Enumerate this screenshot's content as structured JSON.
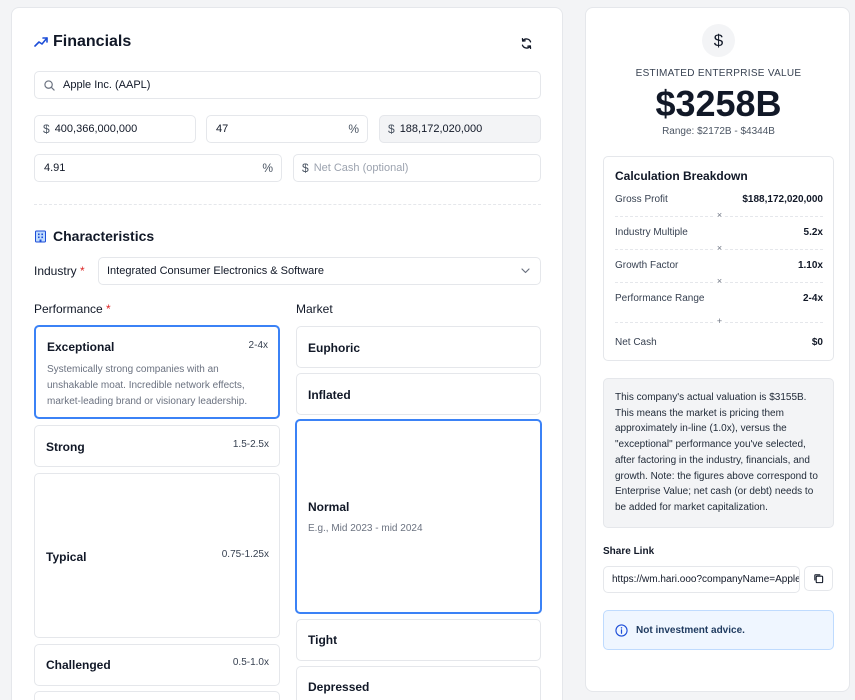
{
  "header": {
    "title": "Financials"
  },
  "company_search": {
    "value": "Apple Inc. (AAPL)"
  },
  "fields": {
    "revenue": {
      "prefix": "$",
      "value": "400,366,000,000"
    },
    "gross_margin": {
      "value": "47",
      "suffix": "%"
    },
    "gross_profit": {
      "prefix": "$",
      "value": "188,172,020,000"
    },
    "growth": {
      "value": "4.91",
      "suffix": "%"
    },
    "net_cash": {
      "prefix": "$",
      "placeholder": "Net Cash (optional)"
    }
  },
  "characteristics": {
    "title": "Characteristics",
    "industry_label": "Industry",
    "required_mark": "*",
    "industry_value": "Integrated Consumer Electronics & Software"
  },
  "performance": {
    "label": "Performance",
    "required_mark": "*",
    "options": [
      {
        "title": "Exceptional",
        "range": "2-4x",
        "desc": "Systemically strong companies with an unshakable moat. Incredible network effects, market-leading brand or visionary leadership.",
        "selected": true
      },
      {
        "title": "Strong",
        "range": "1.5-2.5x",
        "selected": false
      },
      {
        "title": "Typical",
        "range": "0.75-1.25x",
        "selected": false
      },
      {
        "title": "Challenged",
        "range": "0.5-1.0x",
        "selected": false
      }
    ]
  },
  "market": {
    "label": "Market",
    "options": [
      {
        "title": "Euphoric",
        "selected": false
      },
      {
        "title": "Inflated",
        "selected": false
      },
      {
        "title": "Normal",
        "desc": "E.g., Mid 2023 - mid 2024",
        "selected": true
      },
      {
        "title": "Tight",
        "selected": false
      },
      {
        "title": "Depressed",
        "selected": false
      }
    ]
  },
  "valuation": {
    "currency_symbol": "$",
    "caption": "ESTIMATED ENTERPRISE VALUE",
    "value": "$3258B",
    "range": "Range: $2172B - $4344B"
  },
  "breakdown": {
    "title": "Calculation Breakdown",
    "rows": [
      {
        "label": "Gross Profit",
        "value": "$188,172,020,000"
      },
      {
        "label": "Industry Multiple",
        "value": "5.2x"
      },
      {
        "label": "Growth Factor",
        "value": "1.10x"
      },
      {
        "label": "Performance Range",
        "value": "2-4x"
      },
      {
        "label": "Net Cash",
        "value": "$0"
      }
    ],
    "ops": [
      "×",
      "×",
      "×",
      "+"
    ]
  },
  "note": "This company's actual valuation is $3155B. This means the market is pricing them approximately in-line (1.0x), versus the \"exceptional\" performance you've selected, after factoring in the industry, financials, and growth. Note: the figures above correspond to Enterprise Value; net cash (or debt) needs to be added for market capitalization.",
  "share": {
    "label": "Share Link",
    "url": "https://wm.hari.ooo?companyName=Apple"
  },
  "advice": "Not investment advice.",
  "colors": {
    "accent": "#3b82f6",
    "required": "#dc2626"
  }
}
